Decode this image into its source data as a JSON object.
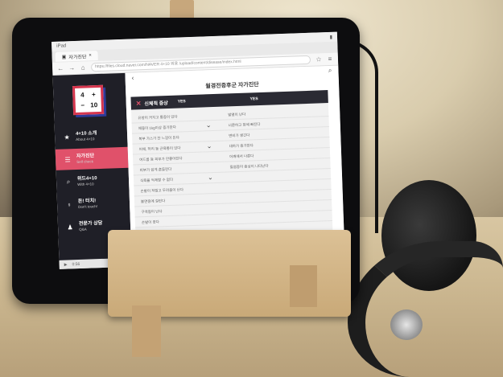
{
  "browser": {
    "status_left": "iPad",
    "tab_label": "자가진단",
    "url": "https://files.cloud.naver.com/NAVER 4+10 외용 /upload/content/disease/index.html"
  },
  "app": {
    "logo": [
      "4",
      "+",
      "−",
      "10"
    ],
    "sidebar": [
      {
        "ko": "4+10 소개",
        "en": "About 4+10",
        "icon": "★"
      },
      {
        "ko": "자가진단",
        "en": "Self check",
        "icon": "☰"
      },
      {
        "ko": "위드4+10",
        "en": "With 4+10",
        "icon": "⌕"
      },
      {
        "ko": "돈! 터치!",
        "en": "Don't touch!",
        "icon": "♀"
      },
      {
        "ko": "전문가 상담",
        "en": "Q&A",
        "icon": "♟"
      }
    ],
    "page_title": "월경전증후군 자가진단",
    "panel_title": "신체적 증상",
    "yes_label": "YES",
    "rows_left": [
      "유방이 커지고 통증이 있다",
      "체중이 1kg이상 증가한다",
      "복부 가스가 찬 느낌이 든다",
      "어깨, 허리 등 근육통이 있다",
      "여드름 등 피부가 안좋아진다",
      "피부가 쉽게 흔들린다",
      "식욕을 억제할 수 없다",
      "손발이 저릴고 두려움이 난다",
      "불면증에 걸린다",
      "구역질이 난다",
      "손발이 붓다"
    ],
    "rows_right": [
      "발열이 난다",
      "너른하고 잠에 빠진다",
      "변비가 생긴다",
      "대하가 증가한다",
      "어깨에서 나른다",
      "질염증이 증상이 나타난다"
    ],
    "video_time": "0:56"
  }
}
